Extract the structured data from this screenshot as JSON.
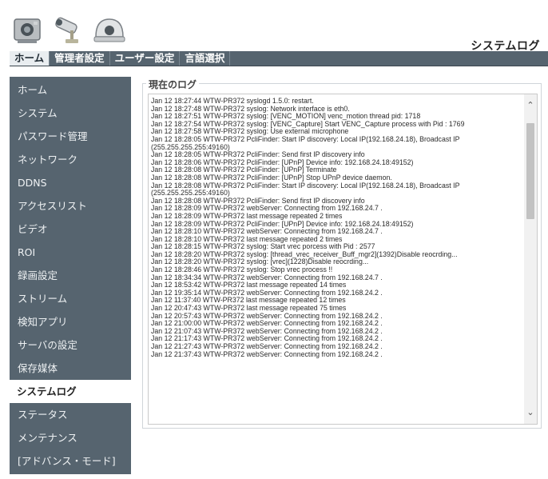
{
  "header": {
    "page_title": "システムログ",
    "device_icons": [
      "camera-icon",
      "cctv-camera-icon",
      "dome-camera-icon"
    ]
  },
  "topnav": {
    "tabs": [
      {
        "label": "ホーム",
        "active": true
      },
      {
        "label": "管理者設定",
        "active": false
      },
      {
        "label": "ユーザー設定",
        "active": false
      },
      {
        "label": "言語選択",
        "active": false
      }
    ]
  },
  "sidebar": {
    "items": [
      {
        "label": "ホーム"
      },
      {
        "label": "システム"
      },
      {
        "label": "パスワード管理"
      },
      {
        "label": "ネットワーク"
      },
      {
        "label": "DDNS"
      },
      {
        "label": "アクセスリスト"
      },
      {
        "label": "ビデオ"
      },
      {
        "label": "ROI"
      },
      {
        "label": "録画設定"
      },
      {
        "label": "ストリーム"
      },
      {
        "label": "検知アプリ"
      },
      {
        "label": "サーバの設定"
      },
      {
        "label": "保存媒体"
      },
      {
        "label": "システムログ",
        "active": true
      },
      {
        "label": "ステータス"
      },
      {
        "label": "メンテナンス"
      },
      {
        "label": "[アドバンス・モード]"
      }
    ]
  },
  "main": {
    "section_title": "現在のログ",
    "log_lines": [
      "Jan 12 18:27:44 WTW-PR372 syslogd 1.5.0: restart.",
      "Jan 12 18:27:48 WTW-PR372 syslog: Network interface is eth0.",
      "Jan 12 18:27:51 WTW-PR372 syslog: [VENC_MOTION] venc_motion thread pid: 1718",
      "Jan 12 18:27:54 WTW-PR372 syslog: [VENC_Capture] Start VENC_Capture process with Pid : 1769",
      "Jan 12 18:27:58 WTW-PR372 syslog: Use external microphone",
      "Jan 12 18:28:05 WTW-PR372 PcliFinder: Start IP discovery: Local IP(192.168.24.18), Broadcast IP (255.255.255.255:49160)",
      "Jan 12 18:28:05 WTW-PR372 PcliFinder: Send first IP discovery info",
      "Jan 12 18:28:06 WTW-PR372 PcliFinder: [UPnP] Device info: 192.168.24.18:49152)",
      "Jan 12 18:28:08 WTW-PR372 PcliFinder: [UPnP] Terminate",
      "Jan 12 18:28:08 WTW-PR372 PcliFinder: [UPnP] Stop UPnP device daemon.",
      "Jan 12 18:28:08 WTW-PR372 PcliFinder: Start IP discovery: Local IP(192.168.24.18), Broadcast IP (255.255.255.255:49160)",
      "Jan 12 18:28:08 WTW-PR372 PcliFinder: Send first IP discovery info",
      "Jan 12 18:28:09 WTW-PR372 webServer: Connecting from 192.168.24.7 .",
      "Jan 12 18:28:09 WTW-PR372 last message repeated 2 times",
      "Jan 12 18:28:09 WTW-PR372 PcliFinder: [UPnP] Device info: 192.168.24.18:49152)",
      "Jan 12 18:28:10 WTW-PR372 webServer: Connecting from 192.168.24.7 .",
      "Jan 12 18:28:10 WTW-PR372 last message repeated 2 times",
      "Jan 12 18:28:15 WTW-PR372 syslog: Start vrec porcess with Pid : 2577",
      "Jan 12 18:28:20 WTW-PR372 syslog: [thread_vrec_receiver_Buff_mgr2](1392)Disable reocrding...",
      "Jan 12 18:28:20 WTW-PR372 syslog: [vrec](1228)Disable reocrding...",
      "Jan 12 18:28:46 WTW-PR372 syslog: Stop vrec process !!",
      "Jan 12 18:34:34 WTW-PR372 webServer: Connecting from 192.168.24.7 .",
      "Jan 12 18:53:42 WTW-PR372 last message repeated 14 times",
      "Jan 12 19:35:14 WTW-PR372 webServer: Connecting from 192.168.24.2 .",
      "Jan 12 11:37:40 WTW-PR372 last message repeated 12 times",
      "Jan 12 20:47:43 WTW-PR372 last message repeated 75 times",
      "Jan 12 20:57:43 WTW-PR372 webServer: Connecting from 192.168.24.2 .",
      "Jan 12 21:00:00 WTW-PR372 webServer: Connecting from 192.168.24.2 .",
      "Jan 12 21:07:43 WTW-PR372 webServer: Connecting from 192.168.24.2 .",
      "Jan 12 21:17:43 WTW-PR372 webServer: Connecting from 192.168.24.2 .",
      "Jan 12 21:27:43 WTW-PR372 webServer: Connecting from 192.168.24.2 .",
      "Jan 12 21:37:43 WTW-PR372 webServer: Connecting from 192.168.24.2 ."
    ]
  },
  "scrollbar": {
    "up_icon": "chevron-up-icon",
    "down_icon": "chevron-down-icon"
  }
}
